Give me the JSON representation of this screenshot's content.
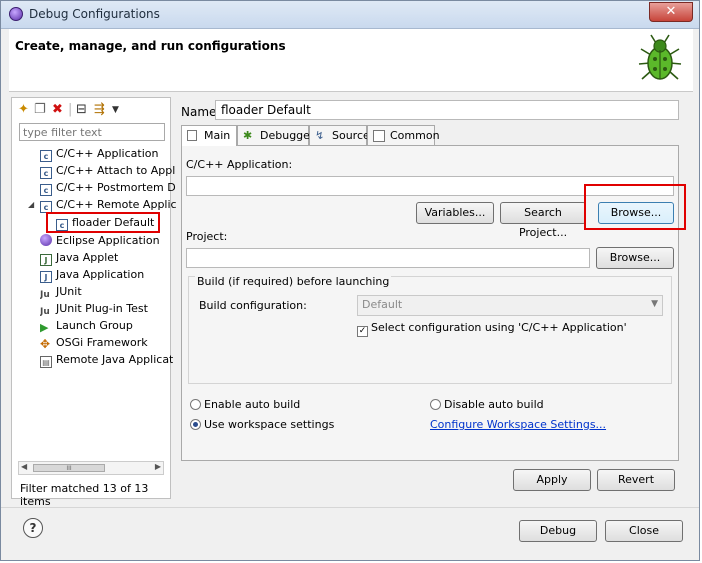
{
  "window": {
    "title": "Debug Configurations",
    "close_glyph": "✕"
  },
  "header": {
    "title": "Create, manage, and run configurations"
  },
  "left": {
    "filter_placeholder": "type filter text",
    "tree": [
      {
        "label": "C/C++ Application",
        "icon": "c-config-icon"
      },
      {
        "label": "C/C++ Attach to Appl",
        "icon": "c-config-icon"
      },
      {
        "label": "C/C++ Postmortem D",
        "icon": "c-config-icon"
      },
      {
        "label": "C/C++ Remote Applic",
        "icon": "c-config-icon",
        "expanded": true
      },
      {
        "label": "floader Default",
        "icon": "c-config-icon",
        "selected": true
      },
      {
        "label": "Eclipse Application",
        "icon": "eclipse-icon"
      },
      {
        "label": "Java Applet",
        "icon": "java-applet-icon"
      },
      {
        "label": "Java Application",
        "icon": "java-app-icon"
      },
      {
        "label": "JUnit",
        "icon": "junit-icon"
      },
      {
        "label": "JUnit Plug-in Test",
        "icon": "junit-plugin-icon"
      },
      {
        "label": "Launch Group",
        "icon": "launch-group-icon"
      },
      {
        "label": "OSGi Framework",
        "icon": "osgi-icon"
      },
      {
        "label": "Remote Java Applicat",
        "icon": "remote-java-icon"
      }
    ],
    "scroll_thumb": "III",
    "status": "Filter matched 13 of 13 items"
  },
  "config": {
    "name_label": "Name:",
    "name_value": "floader Default",
    "tabs": [
      {
        "label": "Main",
        "active": true
      },
      {
        "label": "Debugger"
      },
      {
        "label": "Source"
      },
      {
        "label": "Common"
      }
    ],
    "app_label": "C/C++ Application:",
    "variables_btn": "Variables...",
    "search_project_btn": "Search Project...",
    "browse_app_btn": "Browse...",
    "project_label": "Project:",
    "browse_project_btn": "Browse...",
    "build_group_title": "Build (if required) before launching",
    "build_config_label": "Build configuration:",
    "build_config_value": "Default",
    "select_config_label": "Select configuration using 'C/C++ Application'",
    "enable_auto_build": "Enable auto build",
    "disable_auto_build": "Disable auto build",
    "use_workspace": "Use workspace settings",
    "configure_link": "Configure Workspace Settings...",
    "apply_btn": "Apply",
    "revert_btn": "Revert"
  },
  "footer": {
    "help": "?",
    "debug_btn": "Debug",
    "close_btn": "Close"
  }
}
